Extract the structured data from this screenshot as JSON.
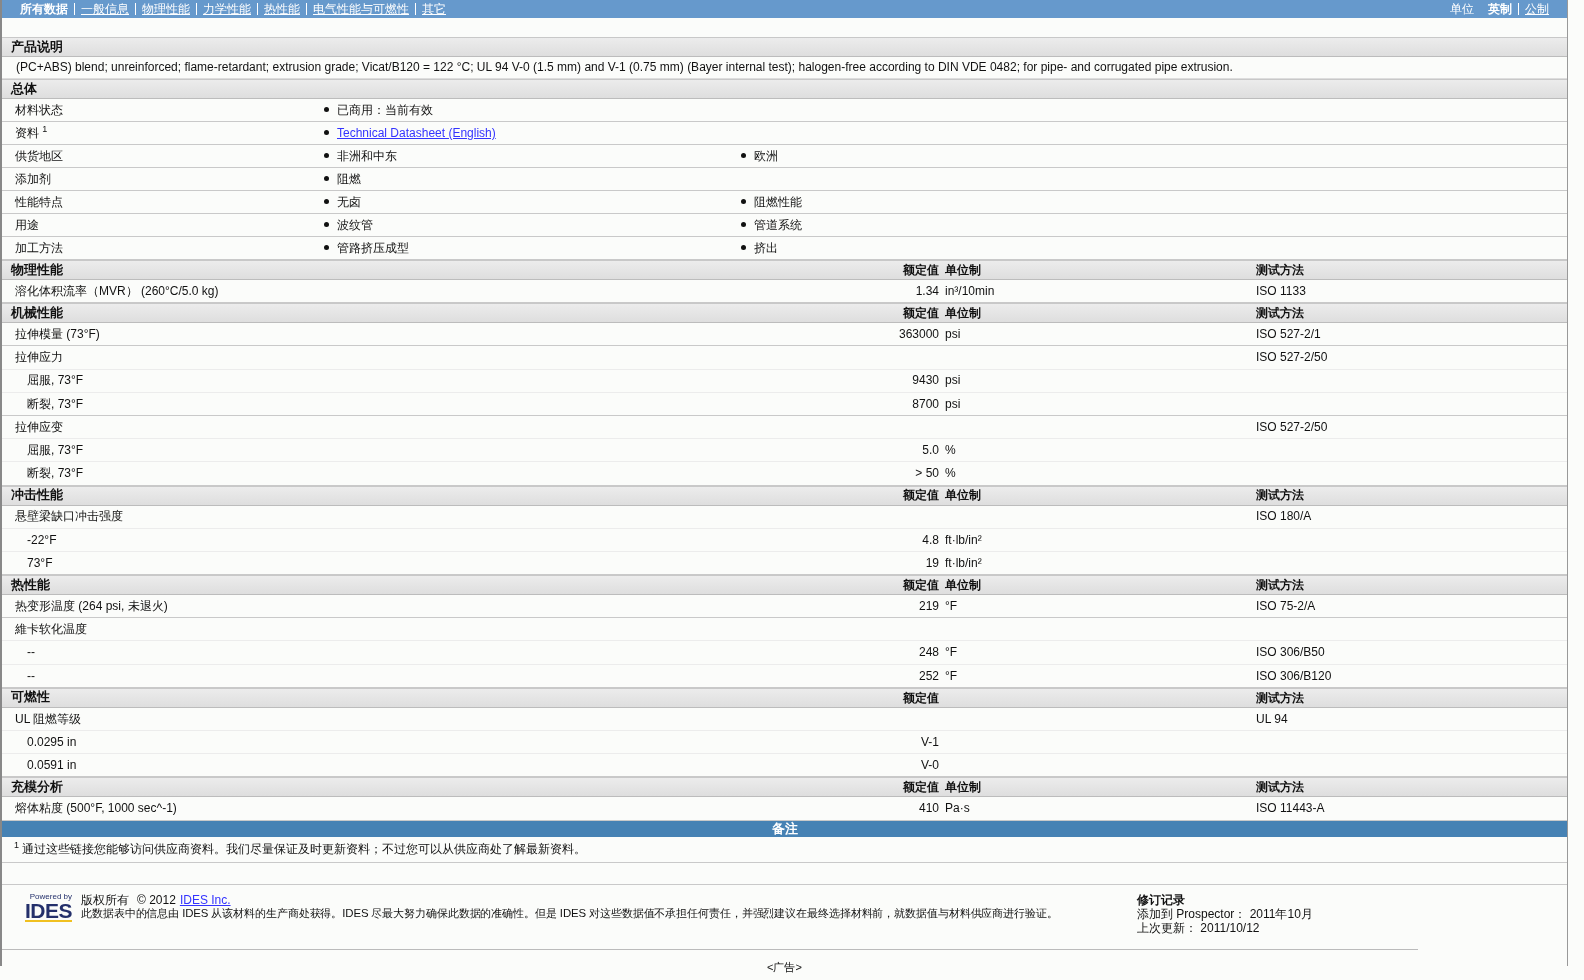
{
  "nav": {
    "tabs": [
      {
        "label": "所有数据",
        "selected": true
      },
      {
        "label": "一般信息",
        "selected": false
      },
      {
        "label": "物理性能",
        "selected": false
      },
      {
        "label": "力学性能",
        "selected": false
      },
      {
        "label": "热性能",
        "selected": false
      },
      {
        "label": "电气性能与可燃性",
        "selected": false
      },
      {
        "label": "其它",
        "selected": false
      }
    ],
    "units_label": "单位",
    "units": [
      {
        "label": "英制",
        "selected": true
      },
      {
        "label": "公制",
        "selected": false
      }
    ]
  },
  "product_description": {
    "title": "产品说明",
    "text": "(PC+ABS) blend; unreinforced; flame-retardant; extrusion grade; Vicat/B120 = 122 °C; UL 94 V-0 (1.5 mm) and V-1 (0.75 mm) (Bayer internal test); halogen-free according to DIN VDE 0482; for pipe- and corrugated pipe extrusion."
  },
  "general": {
    "title": "总体",
    "rows": [
      {
        "label": "材料状态",
        "values": [
          {
            "kind": "text",
            "text": "已商用：当前有效"
          }
        ]
      },
      {
        "label": "资料 $^{1}$",
        "values": [
          {
            "kind": "link",
            "text": "Technical Datasheet (English)"
          }
        ]
      },
      {
        "label": "供货地区",
        "values": [
          {
            "kind": "text",
            "text": "非洲和中东"
          },
          {
            "kind": "text",
            "text": "欧洲"
          }
        ]
      },
      {
        "label": "添加剂",
        "values": [
          {
            "kind": "text",
            "text": "阻燃"
          }
        ]
      },
      {
        "label": "性能特点",
        "values": [
          {
            "kind": "text",
            "text": "无卤"
          },
          {
            "kind": "text",
            "text": "阻燃性能"
          }
        ]
      },
      {
        "label": "用途",
        "values": [
          {
            "kind": "text",
            "text": "波纹管"
          },
          {
            "kind": "text",
            "text": "管道系统"
          }
        ]
      },
      {
        "label": "加工方法",
        "values": [
          {
            "kind": "text",
            "text": "管路挤压成型"
          },
          {
            "kind": "text",
            "text": "挤出"
          }
        ]
      }
    ]
  },
  "property_sections": [
    {
      "title": "物理性能",
      "headers": {
        "value": "额定值",
        "unit": "单位制",
        "method": "测试方法"
      },
      "rows": [
        {
          "label": "溶化体积流率（MVR） (260°C/5.0 kg)",
          "value": "1.34",
          "unit": "in³/10min",
          "method": "ISO 1133"
        }
      ]
    },
    {
      "title": "机械性能",
      "headers": {
        "value": "额定值",
        "unit": "单位制",
        "method": "测试方法"
      },
      "rows": [
        {
          "label": "拉伸模量 (73°F)",
          "value": "363000",
          "unit": "psi",
          "method": "ISO 527-2/1"
        },
        {
          "label": "拉伸应力",
          "method": "ISO 527-2/50",
          "children": [
            {
              "label": "屈服, 73°F",
              "value": "9430",
              "unit": "psi"
            },
            {
              "label": "断裂, 73°F",
              "value": "8700",
              "unit": "psi"
            }
          ]
        },
        {
          "label": "拉伸应变",
          "method": "ISO 527-2/50",
          "children": [
            {
              "label": "屈服, 73°F",
              "value": "5.0",
              "unit": "%"
            },
            {
              "label": "断裂, 73°F",
              "value": "> 50",
              "unit": "%"
            }
          ]
        }
      ]
    },
    {
      "title": "冲击性能",
      "headers": {
        "value": "额定值",
        "unit": "单位制",
        "method": "测试方法"
      },
      "rows": [
        {
          "label": "悬壁梁缺口冲击强度",
          "method": "ISO 180/A",
          "children": [
            {
              "label": "-22°F",
              "value": "4.8",
              "unit": "ft·lb/in²"
            },
            {
              "label": "73°F",
              "value": "19",
              "unit": "ft·lb/in²"
            }
          ]
        }
      ]
    },
    {
      "title": "热性能",
      "headers": {
        "value": "额定值",
        "unit": "单位制",
        "method": "测试方法"
      },
      "rows": [
        {
          "label": "热变形温度 (264 psi, 未退火)",
          "value": "219",
          "unit": "°F",
          "method": "ISO 75-2/A"
        },
        {
          "label": "維卡软化温度",
          "children": [
            {
              "label": "--",
              "value": "248",
              "unit": "°F",
              "method": "ISO 306/B50"
            },
            {
              "label": "--",
              "value": "252",
              "unit": "°F",
              "method": "ISO 306/B120"
            }
          ]
        }
      ]
    },
    {
      "title": "可燃性",
      "headers": {
        "value": "额定值",
        "method": "测试方法"
      },
      "rows": [
        {
          "label": "UL 阻燃等级",
          "method": "UL 94",
          "children": [
            {
              "label": "0.0295 in",
              "value": "V-1"
            },
            {
              "label": "0.0591 in",
              "value": "V-0"
            }
          ]
        }
      ]
    },
    {
      "title": "充模分析",
      "headers": {
        "value": "额定值",
        "unit": "单位制",
        "method": "测试方法"
      },
      "rows": [
        {
          "label": "熔体粘度 (500°F, 1000 sec^-1)",
          "value": "410",
          "unit": "Pa·s",
          "method": "ISO 11443-A"
        }
      ]
    }
  ],
  "notes": {
    "title": "备注",
    "text": "$^{1}$ 通过这些链接您能够访问供应商资料。我们尽量保证及时更新资料；不过您可以从供应商处了解最新资料。"
  },
  "footer": {
    "logo_caption": "Powered by",
    "logo_text": "IDES",
    "copyright_label": "版权所有",
    "copyright_year": "© 2012",
    "copyright_link": "IDES Inc.",
    "disclaimer": "此数据表中的信息由 IDES 从该材料的生产商处获得。IDES 尽最大努力确保此数据的准确性。但是 IDES 对这些数据值不承担任何责任，并强烈建议在最终选择材料前，就数据值与材料供应商进行验证。",
    "revision_title": "修订记录",
    "added": "添加到 Prospector： 2011年10月",
    "updated": "上次更新： 2011/10/12"
  },
  "ad": "<广告>"
}
